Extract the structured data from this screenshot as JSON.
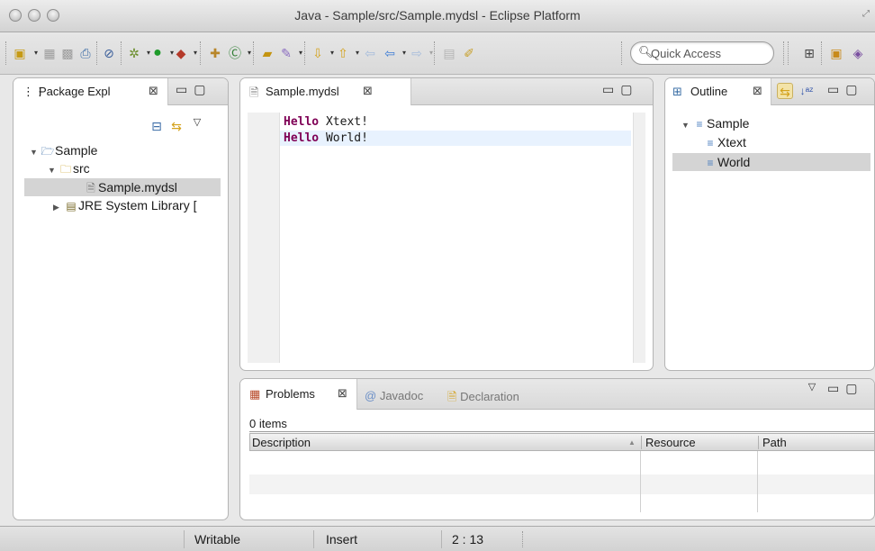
{
  "window": {
    "title": "Java - Sample/src/Sample.mydsl - Eclipse Platform"
  },
  "toolbar": {
    "quick_access_placeholder": "Quick Access",
    "icons": [
      "new-wizard-icon",
      "save-icon",
      "save-all-icon",
      "print-icon",
      "skip-breakpoints-icon",
      "debug-icon",
      "run-icon",
      "external-tools-icon",
      "new-java-package-icon",
      "new-java-class-icon",
      "open-type-icon",
      "search-icon",
      "next-annotation-icon",
      "previous-annotation-icon",
      "back-icon",
      "forward-icon",
      "pin-editor-icon",
      "open-perspective-icon",
      "java-perspective-icon"
    ]
  },
  "package_explorer": {
    "tab_label": "Package Expl",
    "tree": [
      {
        "label": "Sample",
        "icon": "project-icon",
        "expanded": true,
        "level": 0
      },
      {
        "label": "src",
        "icon": "source-folder-icon",
        "expanded": true,
        "level": 1
      },
      {
        "label": "Sample.mydsl",
        "icon": "file-icon",
        "level": 2,
        "selected": true
      },
      {
        "label": "JRE System Library [",
        "icon": "library-icon",
        "expanded": false,
        "level": 1
      }
    ]
  },
  "editor": {
    "tab_label": "Sample.mydsl",
    "lines": [
      {
        "keyword": "Hello",
        "rest": " Xtext!"
      },
      {
        "keyword": "Hello",
        "rest": " World!"
      }
    ]
  },
  "outline": {
    "tab_label": "Outline",
    "tree": [
      {
        "label": "Sample",
        "level": 0,
        "expanded": true
      },
      {
        "label": "Xtext",
        "level": 1
      },
      {
        "label": "World",
        "level": 1,
        "selected": true
      }
    ]
  },
  "problems": {
    "tabs": [
      {
        "label": "Problems",
        "active": true
      },
      {
        "label": "Javadoc",
        "active": false,
        "prefix": "@"
      },
      {
        "label": "Declaration",
        "active": false
      }
    ],
    "count_text": "0 items",
    "columns": [
      "Description",
      "Resource",
      "Path"
    ]
  },
  "statusbar": {
    "writable": "Writable",
    "insert_mode": "Insert",
    "cursor": "2 : 13"
  },
  "colors": {
    "keyword": "#7f0055",
    "selection": "#d4d4d4",
    "current_line": "#e8f2fe"
  }
}
